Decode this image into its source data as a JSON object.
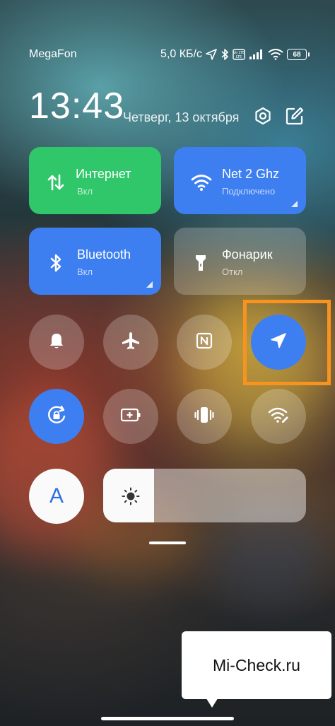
{
  "status_bar": {
    "carrier": "MegaFon",
    "speed": "5,0 КБ/с",
    "volte_label": "Vo LTE",
    "battery": "68"
  },
  "header": {
    "time": "13:43",
    "date": "Четверг, 13 октября"
  },
  "tiles": [
    {
      "label": "Интернет",
      "state": "Вкл",
      "color": "#2fc76a",
      "icon": "mobile-data-icon"
    },
    {
      "label": "Net 2 Ghz",
      "state": "Подключено",
      "color": "#3d7ff0",
      "icon": "wifi-icon"
    },
    {
      "label": "Bluetooth",
      "state": "Вкл",
      "color": "#3d7ff0",
      "icon": "bluetooth-icon"
    },
    {
      "label": "Фонарик",
      "state": "Откл",
      "color": "rgba(255,255,255,0.22)",
      "icon": "flashlight-icon"
    }
  ],
  "toggles": [
    {
      "name": "bell-icon",
      "on": false
    },
    {
      "name": "airplane-icon",
      "on": false
    },
    {
      "name": "nfc-icon",
      "on": false
    },
    {
      "name": "location-icon",
      "on": true
    },
    {
      "name": "rotation-lock-icon",
      "on": true
    },
    {
      "name": "battery-saver-icon",
      "on": false
    },
    {
      "name": "vibrate-icon",
      "on": false
    },
    {
      "name": "wifi-edit-icon",
      "on": false
    }
  ],
  "auto_brightness_label": "A",
  "brightness_level": 0.25,
  "watermark": "Mi-Check.ru",
  "colors": {
    "accent_blue": "#3d7ff0",
    "accent_green": "#2fc76a",
    "highlight_orange": "#f7931e"
  }
}
